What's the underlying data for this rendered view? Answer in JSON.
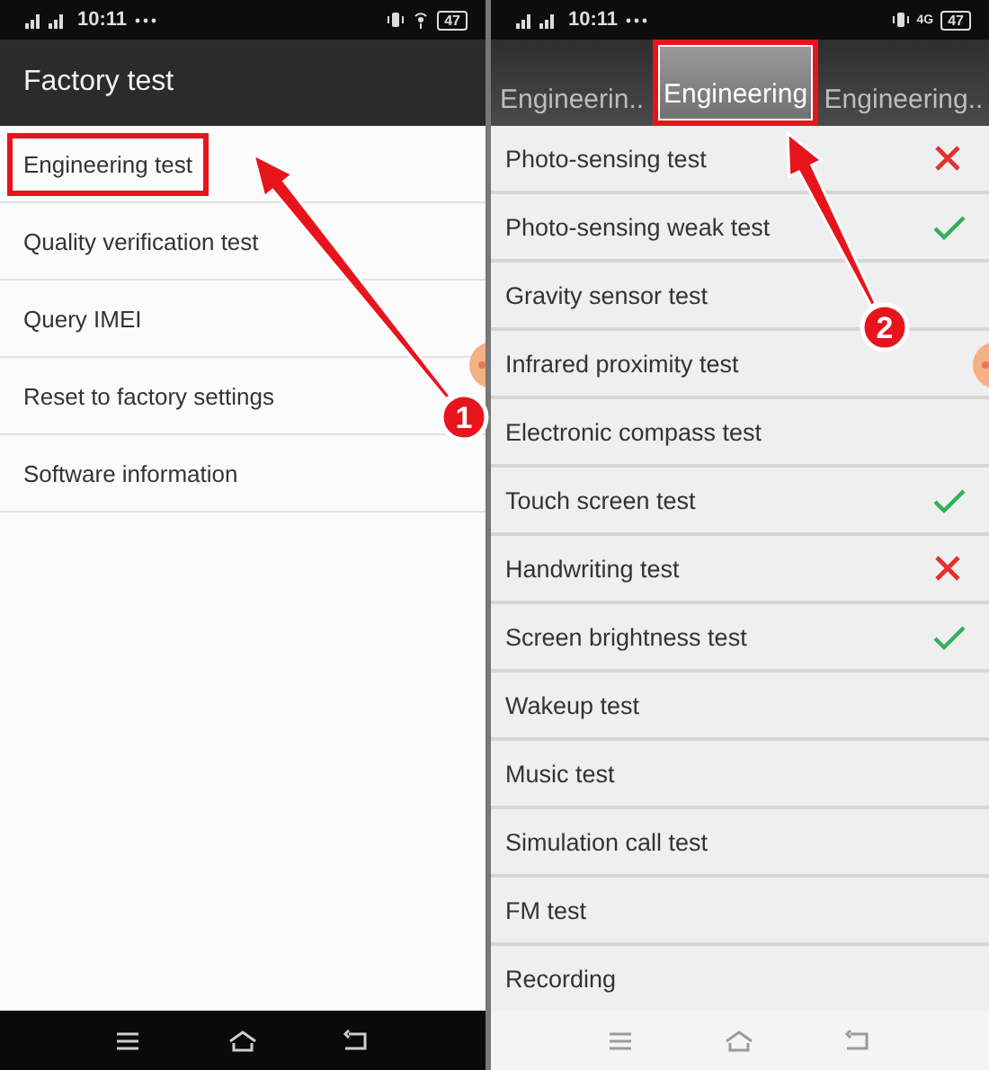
{
  "screens": [
    {
      "kind": "menu",
      "status_bar": {
        "time": "10:11",
        "battery": "47"
      },
      "title": "Factory test",
      "items": [
        {
          "label": "Engineering test",
          "highlighted": true
        },
        {
          "label": "Quality verification test",
          "highlighted": false
        },
        {
          "label": "Query IMEI",
          "highlighted": false
        },
        {
          "label": "Reset to factory settings",
          "highlighted": false
        },
        {
          "label": "Software information",
          "highlighted": false
        }
      ],
      "nav_bar": {
        "dark": true
      }
    },
    {
      "kind": "tests",
      "status_bar": {
        "time": "10:11",
        "network": "4G",
        "battery": "47"
      },
      "tabs": [
        {
          "label": "Engineerin..",
          "selected": false,
          "highlighted": false
        },
        {
          "label": "Engineering",
          "selected": true,
          "highlighted": true
        },
        {
          "label": "Engineering..",
          "selected": false,
          "highlighted": false
        }
      ],
      "tests": [
        {
          "label": "Photo-sensing test",
          "kind": "failed"
        },
        {
          "label": "Photo-sensing weak test",
          "kind": "passed"
        },
        {
          "label": "Gravity sensor test",
          "kind": "untested"
        },
        {
          "label": "Infrared proximity test",
          "kind": "untested"
        },
        {
          "label": "Electronic compass test",
          "kind": "untested"
        },
        {
          "label": "Touch screen test",
          "kind": "passed"
        },
        {
          "label": "Handwriting test",
          "kind": "failed"
        },
        {
          "label": "Screen brightness test",
          "kind": "passed"
        },
        {
          "label": "Wakeup test",
          "kind": "untested"
        },
        {
          "label": "Music test",
          "kind": "untested"
        },
        {
          "label": "Simulation call test",
          "kind": "untested"
        },
        {
          "label": "FM test",
          "kind": "untested"
        },
        {
          "label": "Recording",
          "kind": "untested"
        }
      ],
      "nav_bar": {
        "dark": false
      }
    }
  ],
  "annotations": [
    {
      "number": "1"
    },
    {
      "number": "2"
    }
  ]
}
